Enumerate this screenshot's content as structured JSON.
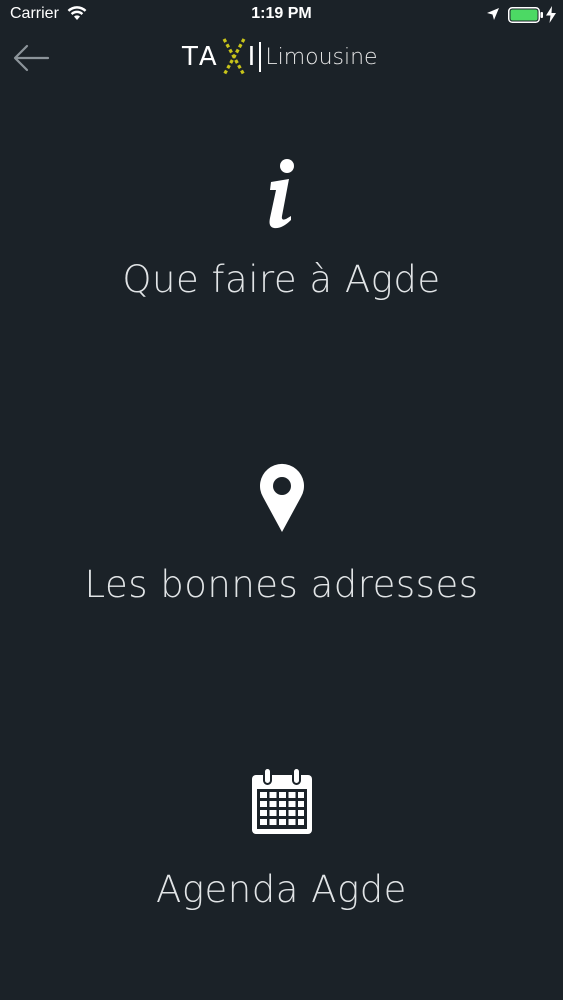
{
  "status_bar": {
    "carrier": "Carrier",
    "time": "1:19 PM",
    "battery_color": "#4cd964"
  },
  "nav": {
    "logo_taxi_left": "TA",
    "logo_taxi_right": "I",
    "logo_limousine": "Limousine",
    "logo_x_color": "#c8c41a"
  },
  "menu": {
    "items": [
      {
        "label": "Que faire à Agde",
        "icon": "info-icon"
      },
      {
        "label": "Les bonnes adresses",
        "icon": "map-pin-icon"
      },
      {
        "label": "Agenda Agde",
        "icon": "calendar-icon"
      }
    ]
  }
}
